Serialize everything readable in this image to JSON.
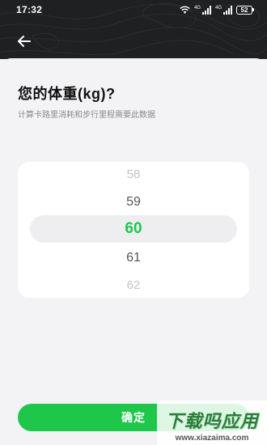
{
  "status_bar": {
    "time": "17:32",
    "wifi_icon": "wifi-icon",
    "signal_icons": [
      "signal-1-icon",
      "signal-2-icon"
    ],
    "battery": "52"
  },
  "header": {
    "back_icon": "arrow-left-icon"
  },
  "main": {
    "title": "您的体重(kg)?",
    "subtitle": "计算卡路里消耗和步行里程需要此数据"
  },
  "picker": {
    "options": [
      "58",
      "59",
      "60",
      "61",
      "62"
    ],
    "selected": "60",
    "accent_color": "#1ec74a"
  },
  "confirm_button": {
    "label": "确定"
  },
  "watermark": {
    "title": "下载吗应用",
    "url": "www.xiazaima.com"
  },
  "colors": {
    "accent": "#1ec74a",
    "header_bg": "#1f2022",
    "page_bg": "#f3f3f5"
  }
}
